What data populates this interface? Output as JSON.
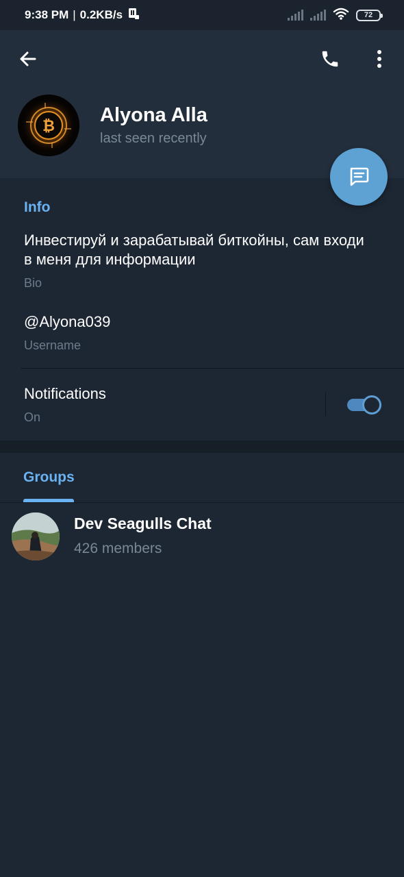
{
  "status_bar": {
    "time": "9:38 PM",
    "separator": "|",
    "network_speed": "0.2KB/s",
    "battery": "72",
    "icons": [
      "device-icon",
      "signal-icon",
      "signal-icon",
      "wifi-icon",
      "battery-icon"
    ]
  },
  "profile": {
    "name": "Alyona Alla",
    "status": "last seen recently"
  },
  "toolbar": {
    "icons": [
      "back-arrow-icon",
      "phone-icon",
      "more-vert-icon",
      "message-icon"
    ]
  },
  "info": {
    "title": "Info",
    "bio_text": "Инвестируй и зарабатывай биткойны, сам входи в меня для информации",
    "bio_label": "Bio",
    "username": "@Alyona039",
    "username_label": "Username",
    "notifications_title": "Notifications",
    "notifications_state": "On"
  },
  "tabs": {
    "groups_label": "Groups"
  },
  "groups": [
    {
      "name": "Dev Seagulls Chat",
      "members": "426 members"
    }
  ],
  "colors": {
    "accent": "#6ab2f2",
    "fab": "#5ea1d3",
    "background": "#1d2733",
    "header": "#232e3c",
    "secondary_text": "#7a8896"
  },
  "toggle": {
    "notifications_on": true
  }
}
